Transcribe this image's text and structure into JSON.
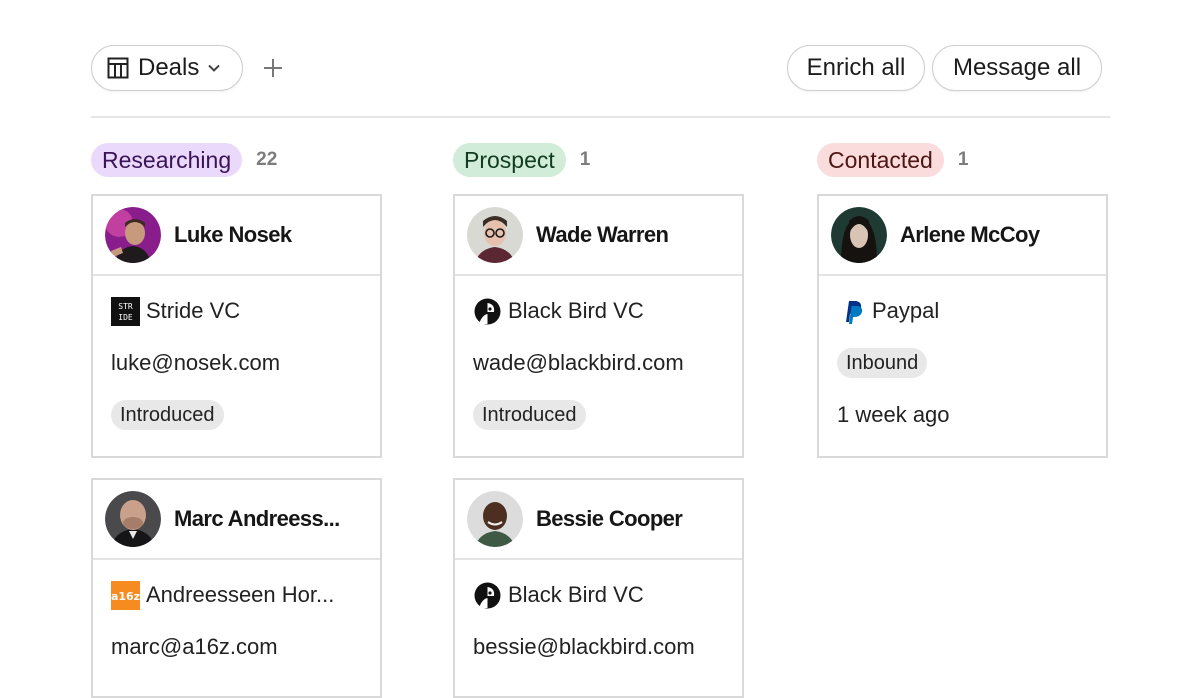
{
  "toolbar": {
    "view_label": "Deals",
    "enrich_label": "Enrich all",
    "message_label": "Message all"
  },
  "columns": [
    {
      "status": "Researching",
      "count": "22",
      "color": "#ead9fa",
      "text_color": "#3a1458",
      "cards": [
        {
          "name": "Luke Nosek",
          "company": "Stride VC",
          "company_logo": "stride-logo",
          "email": "luke@nosek.com",
          "tag": "Introduced"
        },
        {
          "name": "Marc Andreess...",
          "company": "Andreesseen Hor...",
          "company_logo": "a16z-logo",
          "email": "marc@a16z.com"
        }
      ]
    },
    {
      "status": "Prospect",
      "count": "1",
      "color": "#d1ecd8",
      "text_color": "#123b21",
      "cards": [
        {
          "name": "Wade Warren",
          "company": "Black Bird VC",
          "company_logo": "blackbird-logo",
          "email": "wade@blackbird.com",
          "tag": "Introduced"
        },
        {
          "name": "Bessie Cooper",
          "company": "Black Bird VC",
          "company_logo": "blackbird-logo",
          "email": "bessie@blackbird.com"
        }
      ]
    },
    {
      "status": "Contacted",
      "count": "1",
      "color": "#fbdcdc",
      "text_color": "#4e1515",
      "cards": [
        {
          "name": "Arlene McCoy",
          "company": "Paypal",
          "company_logo": "paypal-logo",
          "tag": "Inbound",
          "time": "1 week ago"
        }
      ]
    }
  ]
}
